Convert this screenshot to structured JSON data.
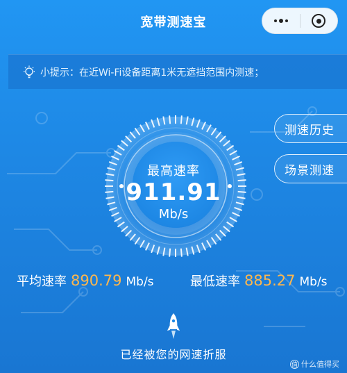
{
  "header": {
    "title": "宽带测速宝",
    "more_icon": "more-dots-icon",
    "close_icon": "target-close-icon"
  },
  "tip": {
    "icon": "lightbulb-icon",
    "label": "小提示：",
    "text": "在近Wi-Fi设备距离1米无遮挡范围内测速；"
  },
  "side_buttons": {
    "history": "测速历史",
    "scene": "场景测速"
  },
  "gauge": {
    "label": "最高速率",
    "value": "911.91",
    "unit": "Mb/s"
  },
  "stats": {
    "avg_label": "平均速率",
    "avg_value": "890.79",
    "avg_unit": "Mb/s",
    "min_label": "最低速率",
    "min_value": "885.27",
    "min_unit": "Mb/s"
  },
  "bottom": {
    "rocket_icon": "rocket-icon",
    "text": "已经被您的网速折服"
  },
  "watermark": {
    "logo_text": "值",
    "text": "什么值得买"
  },
  "colors": {
    "background": "#1e88e5",
    "accent_value": "#ffb74d"
  }
}
